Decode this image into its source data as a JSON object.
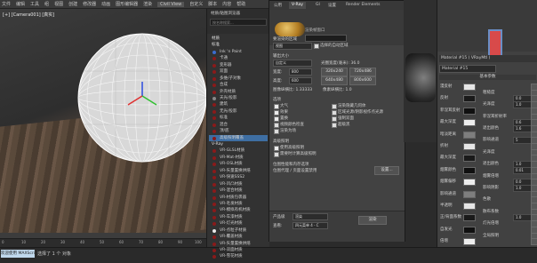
{
  "topbar": {
    "items": [
      "文件",
      "编辑",
      "工具",
      "组",
      "视图",
      "创建",
      "修改器",
      "动画",
      "图形编辑器",
      "渲染",
      "Civil View",
      "自定义",
      "脚本",
      "内容",
      "帮助"
    ],
    "active_index": 10
  },
  "viewport": {
    "label": "[+] [Camera001] [真实]",
    "track_ticks": [
      "0",
      "10",
      "20",
      "30",
      "40",
      "50",
      "60",
      "70",
      "80",
      "90",
      "100"
    ]
  },
  "status": {
    "left_label": "欢迎使用 MAXScri",
    "text": "选择了 1 个 对象"
  },
  "material_browser": {
    "title": "材质/贴图浏览器",
    "search_placeholder": "按名称搜索...",
    "items": [
      {
        "label": "材质",
        "kind": "cat"
      },
      {
        "label": "标准",
        "kind": "cat"
      },
      {
        "label": "Ink 'n Paint",
        "kind": "blue"
      },
      {
        "label": "卡通",
        "kind": "dark"
      },
      {
        "label": "变形器",
        "kind": "dark"
      },
      {
        "label": "双面",
        "kind": "dark"
      },
      {
        "label": "多维/子对象",
        "kind": "dark"
      },
      {
        "label": "合成",
        "kind": "dark"
      },
      {
        "label": "外壳材质",
        "kind": "dark"
      },
      {
        "label": "天光/投影",
        "kind": "gray"
      },
      {
        "label": "建筑",
        "kind": "dark"
      },
      {
        "label": "无光/投影",
        "kind": "dark"
      },
      {
        "label": "标准",
        "kind": "dark"
      },
      {
        "label": "混合",
        "kind": "dark"
      },
      {
        "label": "顶/底",
        "kind": "dark"
      },
      {
        "label": "高级照明覆盖",
        "kind": "sel"
      },
      {
        "label": "V-Ray",
        "kind": "cat"
      },
      {
        "label": "VR-GLSL材质",
        "kind": "dark"
      },
      {
        "label": "VR-Mat-材质",
        "kind": "dark"
      },
      {
        "label": "VR-OSL材质",
        "kind": "dark"
      },
      {
        "label": "VR-矢量置换烘焙",
        "kind": "dark"
      },
      {
        "label": "VR-快速SSS2",
        "kind": "dark"
      },
      {
        "label": "VR-凹凸材质",
        "kind": "dark"
      },
      {
        "label": "VR-混合材质",
        "kind": "dark"
      },
      {
        "label": "VR-材质包裹器",
        "kind": "dark"
      },
      {
        "label": "VR-毛发材质",
        "kind": "dark"
      },
      {
        "label": "VR-模拟有机材质",
        "kind": "dark"
      },
      {
        "label": "VR-车漆材质",
        "kind": "dark"
      },
      {
        "label": "VR-灯光材质",
        "kind": "dark"
      },
      {
        "label": "VR-点粒子材质",
        "kind": "white"
      },
      {
        "label": "VR-覆盖材质",
        "kind": "dark"
      },
      {
        "label": "VR-矢量置换烘焙",
        "kind": "dark"
      },
      {
        "label": "VR-双面材质",
        "kind": "dark"
      },
      {
        "label": "VR-雪花材质",
        "kind": "dark"
      }
    ]
  },
  "render_setup": {
    "tabs": [
      "公用",
      "V-Ray",
      "GI",
      "设置",
      "Render Elements"
    ],
    "active_tab": 1,
    "target_label": "渲染帧窗口",
    "preset_label": "要渲染的区域",
    "area_value": "视图",
    "auto_region": "选择的自动区域",
    "output_size_label": "输出大小",
    "output_preset": "自定义",
    "aperture_label": "光圈宽度(毫米): 36.0",
    "width_label": "宽度:",
    "width_value": "800",
    "height_label": "高度:",
    "height_value": "600",
    "res_buttons": [
      "320x240",
      "720x486",
      "640x480",
      "800x600"
    ],
    "aspect_label": "图像纵横比: 1.33333",
    "pixel_aspect_label": "像素纵横比: 1.0",
    "options_label": "选项",
    "options": [
      "大气",
      "效果",
      "置换",
      "视频颜色检查",
      "渲染为场",
      "渲染隐藏几何体",
      "区域光源/阴影视作点光源",
      "强制双面",
      "超级黑"
    ],
    "advanced_label": "高级照明",
    "advanced": [
      "使用高级照明",
      "需要时计算高级照明"
    ],
    "bitmap_label": "位图性能和内存选项",
    "bitmap_text": "位图代理 / 页面设置禁用",
    "setup_btn": "设置...",
    "product_label": "产品级",
    "preset_field": "渲染",
    "view_label": "查看:",
    "view_value": "四元菜单 4 - C",
    "render_btn": "渲染"
  },
  "slate": {
    "material_title": "Material #15 ( VRayMtl )",
    "material_name": "Material #15",
    "group_label": "基本参数",
    "labels": [
      "漫反射",
      "粗糙度",
      "反射",
      "光泽度",
      "菲涅耳反射",
      "菲涅耳折射率",
      "最大深度",
      "退出颜色",
      "暗淡距离",
      "影响通道",
      "折射",
      "光泽度",
      "最大深度",
      "退出颜色",
      "烟雾颜色",
      "烟雾倍增",
      "烟雾偏移",
      "影响阴影",
      "影响通道",
      "色散",
      "半透明",
      "散布系数",
      "正/背面系数",
      "灯光倍增",
      "自发光",
      "全局照明",
      "倍增"
    ],
    "values": [
      "0.0",
      "1.0",
      "0.6",
      "1.6",
      "5",
      "1.0",
      "0.01",
      "0.0",
      "1.0",
      "1.0"
    ],
    "swatch_colors": [
      "#e6e6e6",
      "#1a1a1a",
      "#101010",
      "#ededed",
      "#7e7e7e"
    ]
  }
}
